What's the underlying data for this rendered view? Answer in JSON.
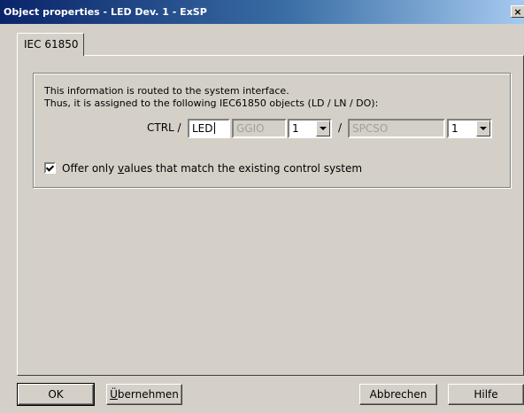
{
  "window": {
    "title": "Object properties - LED Dev. 1 - ExSP",
    "close_glyph": "×"
  },
  "tabs": [
    {
      "label": "IEC 61850"
    }
  ],
  "info": {
    "line1": "This information is routed to the system interface.",
    "line2": "Thus, it is assigned to the following IEC61850 objects (LD / LN / DO):"
  },
  "mapping": {
    "prefix_label": "CTRL /",
    "ld_value": "LED",
    "ln_value": "GGIO",
    "ln_instance": "1",
    "separator": "/",
    "do_value": "SPCSO",
    "do_instance": "1"
  },
  "option": {
    "checked": true,
    "label_pre": "Offer only ",
    "label_accel": "v",
    "label_post": "alues that match the existing control system"
  },
  "buttons": {
    "ok": "OK",
    "apply_accel": "Ü",
    "apply_rest": "bernehmen",
    "cancel": "Abbrechen",
    "help": "Hilfe"
  }
}
